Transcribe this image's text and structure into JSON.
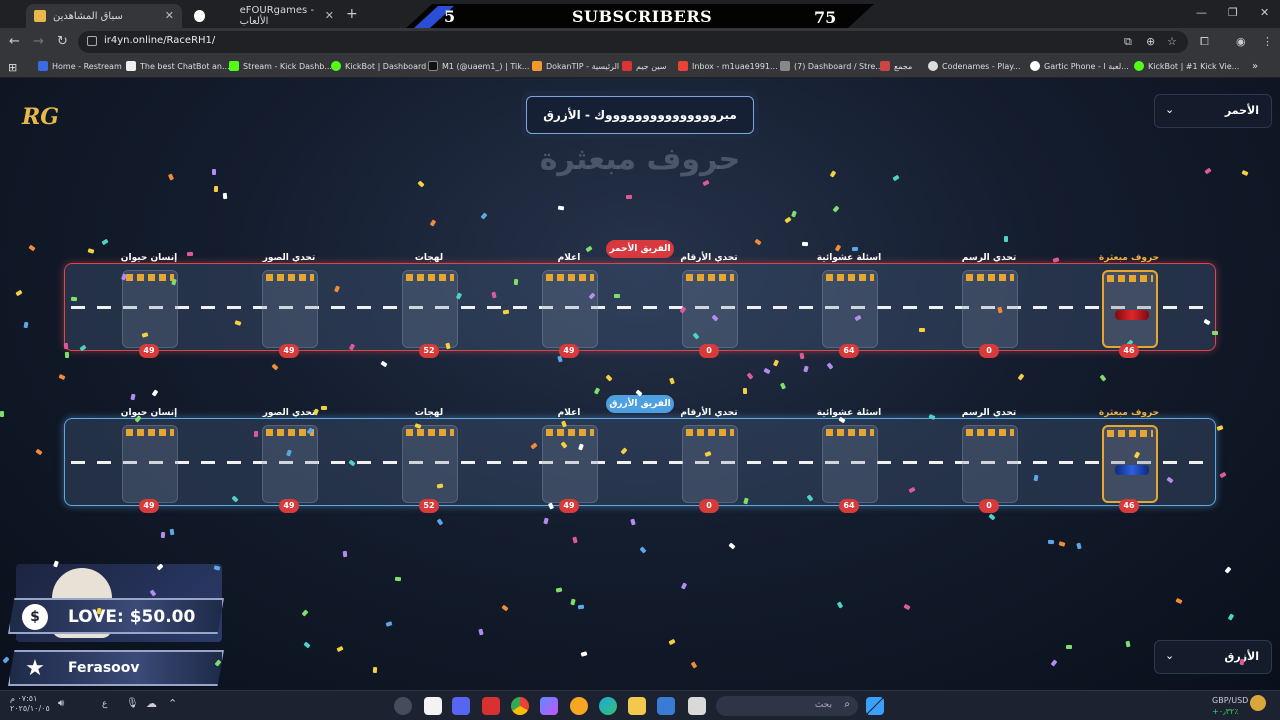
{
  "browser": {
    "tabs": [
      {
        "title": "سباق المشاهدين",
        "active": true
      },
      {
        "title": "eFOURgames - الألعاب",
        "active": false
      }
    ],
    "url": "ir4yn.online/RaceRH1/",
    "bookmarks": [
      "Home - Restream",
      "The best ChatBot an...",
      "Stream - Kick Dashb...",
      "KickBot | Dashboard",
      "M1 (@uaem1_) | Tik...",
      "DokanTIP - الرئيسية",
      "سين جيم",
      "Inbox - m1uae1991...",
      "(7) Dashboard / Stre...",
      "مجمع",
      "Codenames - Play...",
      "Gartic Phone - لعبة ا...",
      "KickBot | #1 Kick Vie..."
    ]
  },
  "subscribers": {
    "current": "5",
    "label": "SUBSCRIBERS",
    "goal": "75"
  },
  "game": {
    "banner_text": "مبروووووووووووووووك - الأزرق",
    "title": "حروف مبعثرة",
    "red_team_label": "الفريق الأحمر",
    "blue_team_label": "الفريق الأزرق",
    "dropdown_top": "الأحمر",
    "dropdown_bottom": "الأزرق",
    "stations": [
      {
        "label": "إنسان حيوان",
        "count": "49"
      },
      {
        "label": "تحدي الصور",
        "count": "49"
      },
      {
        "label": "لهجات",
        "count": "52"
      },
      {
        "label": "اعلام",
        "count": "49"
      },
      {
        "label": "تحدي الأرقام",
        "count": "0"
      },
      {
        "label": "اسئلة عشوائية",
        "count": "64"
      },
      {
        "label": "تحدي الرسم",
        "count": "0"
      },
      {
        "label": "حروف مبعثرة",
        "count": "46"
      }
    ],
    "current_station_index": 7
  },
  "overlay": {
    "logo": "RG",
    "love_icon": "$",
    "love_text": "LOVE: $50.00",
    "follower_name": "Ferasoov"
  },
  "taskbar": {
    "search_placeholder": "بحث",
    "currency": "GBP/USD",
    "currency_change": "+۰٫۳۲٪",
    "time": "٠٧:٥١ م",
    "date": "٢٠٢٥/١٠/٠٥",
    "lang": "ع"
  },
  "colors": {
    "red": "#d9474d",
    "blue": "#5aa8e6",
    "accent": "#e7a630"
  }
}
